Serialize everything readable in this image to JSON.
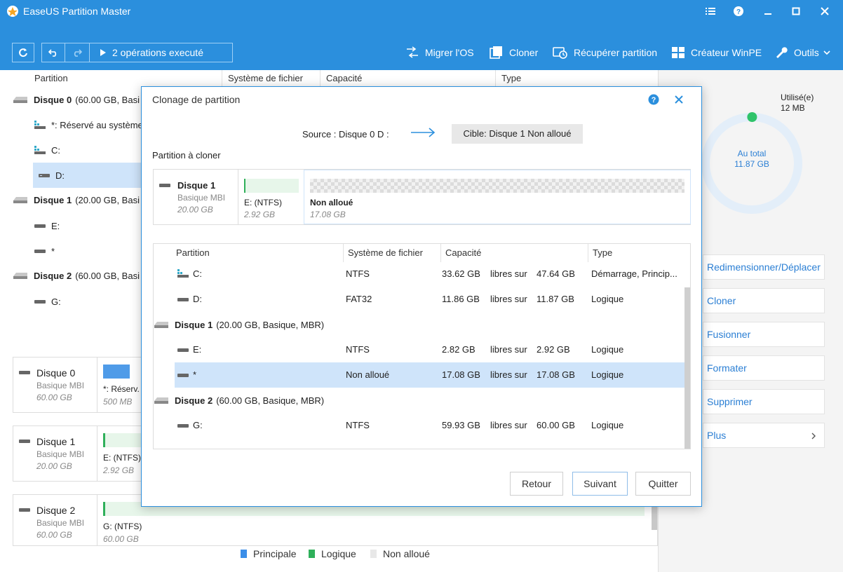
{
  "app": {
    "title": "EaseUS Partition Master"
  },
  "toolbar": {
    "pending_ops": "2 opérations executé",
    "tools": [
      "Migrer l'OS",
      "Cloner",
      "Récupérer partition",
      "Créateur WinPE",
      "Outils"
    ]
  },
  "table": {
    "headers": [
      "Partition",
      "Système de fichier",
      "Capacité",
      "Type"
    ]
  },
  "tree": {
    "disk0": {
      "name": "Disque 0",
      "info": "(60.00 GB, Basi"
    },
    "disk0_parts": [
      "*: Réservé au système",
      "C:",
      "D:"
    ],
    "disk1": {
      "name": "Disque 1",
      "info": "(20.00 GB, Basi"
    },
    "disk1_parts": [
      "E:",
      "*"
    ],
    "disk2": {
      "name": "Disque 2",
      "info": "(60.00 GB, Basi"
    },
    "disk2_parts": [
      "G:"
    ]
  },
  "cards": [
    {
      "name": "Disque 0",
      "type": "Basique MBI",
      "size": "60.00 GB",
      "part_label": "*: Réserv.",
      "part_size": "500 MB"
    },
    {
      "name": "Disque 1",
      "type": "Basique MBI",
      "size": "20.00 GB",
      "part_label": "E: (NTFS)",
      "part_size": "2.92 GB"
    },
    {
      "name": "Disque 2",
      "type": "Basique MBI",
      "size": "60.00 GB",
      "part_label": "G:  (NTFS)",
      "part_size": "60.00 GB"
    }
  ],
  "legend": [
    "Principale",
    "Logique",
    "Non alloué"
  ],
  "colors": {
    "primary": "#2b8fdd",
    "logical": "#2fb05a",
    "unallocated": "#e8e8e8",
    "selected": "#cfe4fa"
  },
  "right": {
    "used_label": "Utilisé(e)",
    "used_value": "12 MB",
    "total_label": "Au total",
    "total_value": "11.87 GB",
    "used_fraction": 0.001,
    "actions": [
      "Redimensionner/Déplacer",
      "Cloner",
      "Fusionner",
      "Formater",
      "Supprimer",
      "Plus"
    ]
  },
  "dialog": {
    "title": "Clonage de partition",
    "source": "Source : Disque 0 D :",
    "target": "Cible: Disque 1 Non alloué",
    "section_label": "Partition à cloner",
    "preview": {
      "disk_name": "Disque 1",
      "disk_type": "Basique MBI",
      "disk_size": "20.00 GB",
      "p1_label": "E:  (NTFS)",
      "p1_size": "2.92 GB",
      "p2_label": "Non alloué",
      "p2_size": "17.08 GB"
    },
    "table_headers": [
      "Partition",
      "Système de fichier",
      "Capacité",
      "Type"
    ],
    "rows": [
      {
        "part": "C:",
        "fs": "NTFS",
        "free": "33.62 GB",
        "sep": "libres sur",
        "total": "47.64 GB",
        "type": "Démarrage, Princip..."
      },
      {
        "part": "D:",
        "fs": "FAT32",
        "free": "11.86 GB",
        "sep": "libres sur",
        "total": "11.87 GB",
        "type": "Logique"
      },
      {
        "part": "E:",
        "fs": "NTFS",
        "free": "2.82 GB",
        "sep": "libres sur",
        "total": "2.92 GB",
        "type": "Logique"
      },
      {
        "part": "*",
        "fs": "Non alloué",
        "free": "17.08 GB",
        "sep": "libres sur",
        "total": "17.08 GB",
        "type": "Logique"
      },
      {
        "part": "G:",
        "fs": "NTFS",
        "free": "59.93 GB",
        "sep": "libres sur",
        "total": "60.00 GB",
        "type": "Logique"
      }
    ],
    "disk_headers": [
      {
        "name": "Disque 1",
        "info": "(20.00 GB, Basique, MBR)"
      },
      {
        "name": "Disque 2",
        "info": "(60.00 GB, Basique, MBR)"
      }
    ],
    "buttons": {
      "back": "Retour",
      "next": "Suivant",
      "quit": "Quitter"
    }
  }
}
